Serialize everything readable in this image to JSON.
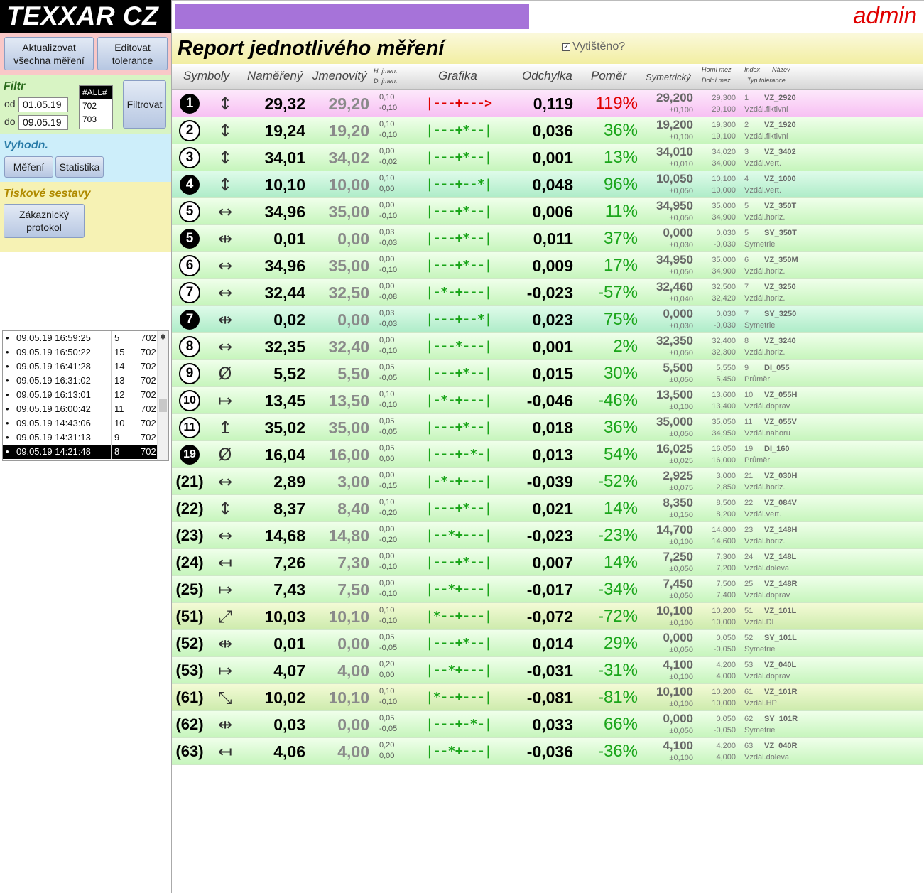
{
  "app": {
    "logo": "TEXXAR CZ",
    "user": "admin"
  },
  "sidebar": {
    "buttons": {
      "update_all": "Aktualizovat všechna měření",
      "edit_tolerance": "Editovat tolerance"
    },
    "filter": {
      "title": "Filtr",
      "from_label": "od",
      "from_value": "01.05.19",
      "to_label": "do",
      "to_value": "09.05.19",
      "list": [
        "#ALL#",
        "702",
        "703"
      ],
      "filter_button": "Filtrovat"
    },
    "eval": {
      "title": "Vyhodn.",
      "measure_button": "Měření",
      "stats_button": "Statistika"
    },
    "print": {
      "title": "Tiskové sestavy",
      "customer_protocol_button": "Zákaznický protokol"
    },
    "log": [
      {
        "bullet": "•",
        "time": "09.05.19 16:59:25",
        "count": "5",
        "code": "702"
      },
      {
        "bullet": "•",
        "time": "09.05.19 16:50:22",
        "count": "15",
        "code": "702"
      },
      {
        "bullet": "•",
        "time": "09.05.19 16:41:28",
        "count": "14",
        "code": "702"
      },
      {
        "bullet": "•",
        "time": "09.05.19 16:31:02",
        "count": "13",
        "code": "702"
      },
      {
        "bullet": "•",
        "time": "09.05.19 16:13:01",
        "count": "12",
        "code": "702"
      },
      {
        "bullet": "•",
        "time": "09.05.19 16:00:42",
        "count": "11",
        "code": "702"
      },
      {
        "bullet": "•",
        "time": "09.05.19 14:43:06",
        "count": "10",
        "code": "702"
      },
      {
        "bullet": "•",
        "time": "09.05.19 14:31:13",
        "count": "9",
        "code": "702"
      },
      {
        "bullet": "•",
        "time": "09.05.19 14:21:48",
        "count": "8",
        "code": "702"
      }
    ]
  },
  "report": {
    "title": "Report jednotlivého měření",
    "printed_label": "Vytištěno?",
    "printed_check": "✓",
    "headers": {
      "symbols": "Symboly",
      "measured": "Naměřený",
      "nominal": "Jmenovitý",
      "h_nom": "H. jmen.",
      "d_nom": "D. jmen.",
      "graph": "Grafika",
      "deviation": "Odchylka",
      "ratio": "Poměr",
      "symmetric": "Symetrický",
      "upper_limit": "Horní mez",
      "lower_limit": "Dolní mez",
      "index": "Index",
      "name": "Název",
      "tol_type": "Typ tolerance"
    },
    "rows": [
      {
        "bg": "pink",
        "badge": "1",
        "badge_style": "dark",
        "arrow": "↕",
        "measured": "29,32",
        "nominal": "29,20",
        "tol_up": "0,10",
        "tol_down": "-0,10",
        "graph": "|---+--->",
        "graph_color": "#e00000",
        "deviation": "0,119",
        "ratio": "119%",
        "ratio_color": "#e00000",
        "sym": "29,200",
        "sym_tol": "±0,100",
        "upper": "29,300",
        "lower": "29,100",
        "index": "1",
        "name": "VZ_2920",
        "type": "Vzdál.fiktivní"
      },
      {
        "bg": "green",
        "badge": "2",
        "badge_style": "light",
        "arrow": "↕",
        "measured": "19,24",
        "nominal": "19,20",
        "tol_up": "0,10",
        "tol_down": "-0,10",
        "graph": "|---+*--|",
        "graph_color": "#1aa51a",
        "deviation": "0,036",
        "ratio": "36%",
        "ratio_color": "#1aa51a",
        "sym": "19,200",
        "sym_tol": "±0,100",
        "upper": "19,300",
        "lower": "19,100",
        "index": "2",
        "name": "VZ_1920",
        "type": "Vzdál.fiktivní"
      },
      {
        "bg": "green",
        "badge": "3",
        "badge_style": "light",
        "arrow": "↕",
        "measured": "34,01",
        "nominal": "34,02",
        "tol_up": "0,00",
        "tol_down": "-0,02",
        "graph": "|---+*--|",
        "graph_color": "#1aa51a",
        "deviation": "0,001",
        "ratio": "13%",
        "ratio_color": "#1aa51a",
        "sym": "34,010",
        "sym_tol": "±0,010",
        "upper": "34,020",
        "lower": "34,000",
        "index": "3",
        "name": "VZ_3402",
        "type": "Vzdál.vert."
      },
      {
        "bg": "teal",
        "badge": "4",
        "badge_style": "dark",
        "arrow": "↕",
        "measured": "10,10",
        "nominal": "10,00",
        "tol_up": "0,10",
        "tol_down": "0,00",
        "graph": "|---+--*|",
        "graph_color": "#1aa51a",
        "deviation": "0,048",
        "ratio": "96%",
        "ratio_color": "#1aa51a",
        "sym": "10,050",
        "sym_tol": "±0,050",
        "upper": "10,100",
        "lower": "10,000",
        "index": "4",
        "name": "VZ_1000",
        "type": "Vzdál.vert."
      },
      {
        "bg": "green",
        "badge": "5",
        "badge_style": "light",
        "arrow": "↔",
        "measured": "34,96",
        "nominal": "35,00",
        "tol_up": "0,00",
        "tol_down": "-0,10",
        "graph": "|---+*--|",
        "graph_color": "#1aa51a",
        "deviation": "0,006",
        "ratio": "11%",
        "ratio_color": "#1aa51a",
        "sym": "34,950",
        "sym_tol": "±0,050",
        "upper": "35,000",
        "lower": "34,900",
        "index": "5",
        "name": "VZ_350T",
        "type": "Vzdál.horiz."
      },
      {
        "bg": "green",
        "badge": "5",
        "badge_style": "dark",
        "arrow": "⇹",
        "measured": "0,01",
        "nominal": "0,00",
        "tol_up": "0,03",
        "tol_down": "-0,03",
        "graph": "|---+*--|",
        "graph_color": "#1aa51a",
        "deviation": "0,011",
        "ratio": "37%",
        "ratio_color": "#1aa51a",
        "sym": "0,000",
        "sym_tol": "±0,030",
        "upper": "0,030",
        "lower": "-0,030",
        "index": "5",
        "name": "SY_350T",
        "type": "Symetrie"
      },
      {
        "bg": "green",
        "badge": "6",
        "badge_style": "light",
        "arrow": "↔",
        "measured": "34,96",
        "nominal": "35,00",
        "tol_up": "0,00",
        "tol_down": "-0,10",
        "graph": "|---+*--|",
        "graph_color": "#1aa51a",
        "deviation": "0,009",
        "ratio": "17%",
        "ratio_color": "#1aa51a",
        "sym": "34,950",
        "sym_tol": "±0,050",
        "upper": "35,000",
        "lower": "34,900",
        "index": "6",
        "name": "VZ_350M",
        "type": "Vzdál.horiz."
      },
      {
        "bg": "green",
        "badge": "7",
        "badge_style": "light",
        "arrow": "↔",
        "measured": "32,44",
        "nominal": "32,50",
        "tol_up": "0,00",
        "tol_down": "-0,08",
        "graph": "|-*-+---|",
        "graph_color": "#1aa51a",
        "deviation": "-0,023",
        "ratio": "-57%",
        "ratio_color": "#1aa51a",
        "sym": "32,460",
        "sym_tol": "±0,040",
        "upper": "32,500",
        "lower": "32,420",
        "index": "7",
        "name": "VZ_3250",
        "type": "Vzdál.horiz."
      },
      {
        "bg": "teal",
        "badge": "7",
        "badge_style": "dark",
        "arrow": "⇹",
        "measured": "0,02",
        "nominal": "0,00",
        "tol_up": "0,03",
        "tol_down": "-0,03",
        "graph": "|---+--*|",
        "graph_color": "#1aa51a",
        "deviation": "0,023",
        "ratio": "75%",
        "ratio_color": "#1aa51a",
        "sym": "0,000",
        "sym_tol": "±0,030",
        "upper": "0,030",
        "lower": "-0,030",
        "index": "7",
        "name": "SY_3250",
        "type": "Symetrie"
      },
      {
        "bg": "green",
        "badge": "8",
        "badge_style": "light",
        "arrow": "↔",
        "measured": "32,35",
        "nominal": "32,40",
        "tol_up": "0,00",
        "tol_down": "-0,10",
        "graph": "|---*---|",
        "graph_color": "#1aa51a",
        "deviation": "0,001",
        "ratio": "2%",
        "ratio_color": "#1aa51a",
        "sym": "32,350",
        "sym_tol": "±0,050",
        "upper": "32,400",
        "lower": "32,300",
        "index": "8",
        "name": "VZ_3240",
        "type": "Vzdál.horiz."
      },
      {
        "bg": "green",
        "badge": "9",
        "badge_style": "light",
        "arrow": "Ø",
        "measured": "5,52",
        "nominal": "5,50",
        "tol_up": "0,05",
        "tol_down": "-0,05",
        "graph": "|---+*--|",
        "graph_color": "#1aa51a",
        "deviation": "0,015",
        "ratio": "30%",
        "ratio_color": "#1aa51a",
        "sym": "5,500",
        "sym_tol": "±0,050",
        "upper": "5,550",
        "lower": "5,450",
        "index": "9",
        "name": "DI_055",
        "type": "Průměr"
      },
      {
        "bg": "green",
        "badge": "10",
        "badge_style": "light",
        "arrow": "↦",
        "measured": "13,45",
        "nominal": "13,50",
        "tol_up": "0,10",
        "tol_down": "-0,10",
        "graph": "|-*-+---|",
        "graph_color": "#1aa51a",
        "deviation": "-0,046",
        "ratio": "-46%",
        "ratio_color": "#1aa51a",
        "sym": "13,500",
        "sym_tol": "±0,100",
        "upper": "13,600",
        "lower": "13,400",
        "index": "10",
        "name": "VZ_055H",
        "type": "Vzdál.doprav"
      },
      {
        "bg": "green",
        "badge": "11",
        "badge_style": "light",
        "arrow": "↥",
        "measured": "35,02",
        "nominal": "35,00",
        "tol_up": "0,05",
        "tol_down": "-0,05",
        "graph": "|---+*--|",
        "graph_color": "#1aa51a",
        "deviation": "0,018",
        "ratio": "36%",
        "ratio_color": "#1aa51a",
        "sym": "35,000",
        "sym_tol": "±0,050",
        "upper": "35,050",
        "lower": "34,950",
        "index": "11",
        "name": "VZ_055V",
        "type": "Vzdál.nahoru"
      },
      {
        "bg": "green",
        "badge": "19",
        "badge_style": "dark",
        "arrow": "Ø",
        "measured": "16,04",
        "nominal": "16,00",
        "tol_up": "0,05",
        "tol_down": "0,00",
        "graph": "|---+-*-|",
        "graph_color": "#1aa51a",
        "deviation": "0,013",
        "ratio": "54%",
        "ratio_color": "#1aa51a",
        "sym": "16,025",
        "sym_tol": "±0,025",
        "upper": "16,050",
        "lower": "16,000",
        "index": "19",
        "name": "DI_160",
        "type": "Průměr"
      },
      {
        "bg": "green",
        "badge": "(21)",
        "badge_style": "text",
        "arrow": "↔",
        "measured": "2,89",
        "nominal": "3,00",
        "tol_up": "0,00",
        "tol_down": "-0,15",
        "graph": "|-*-+---|",
        "graph_color": "#1aa51a",
        "deviation": "-0,039",
        "ratio": "-52%",
        "ratio_color": "#1aa51a",
        "sym": "2,925",
        "sym_tol": "±0,075",
        "upper": "3,000",
        "lower": "2,850",
        "index": "21",
        "name": "VZ_030H",
        "type": "Vzdál.horiz."
      },
      {
        "bg": "green",
        "badge": "(22)",
        "badge_style": "text",
        "arrow": "↕",
        "measured": "8,37",
        "nominal": "8,40",
        "tol_up": "0,10",
        "tol_down": "-0,20",
        "graph": "|---+*--|",
        "graph_color": "#1aa51a",
        "deviation": "0,021",
        "ratio": "14%",
        "ratio_color": "#1aa51a",
        "sym": "8,350",
        "sym_tol": "±0,150",
        "upper": "8,500",
        "lower": "8,200",
        "index": "22",
        "name": "VZ_084V",
        "type": "Vzdál.vert."
      },
      {
        "bg": "green",
        "badge": "(23)",
        "badge_style": "text",
        "arrow": "↔",
        "measured": "14,68",
        "nominal": "14,80",
        "tol_up": "0,00",
        "tol_down": "-0,20",
        "graph": "|--*+---|",
        "graph_color": "#1aa51a",
        "deviation": "-0,023",
        "ratio": "-23%",
        "ratio_color": "#1aa51a",
        "sym": "14,700",
        "sym_tol": "±0,100",
        "upper": "14,800",
        "lower": "14,600",
        "index": "23",
        "name": "VZ_148H",
        "type": "Vzdál.horiz."
      },
      {
        "bg": "green",
        "badge": "(24)",
        "badge_style": "text",
        "arrow": "↤",
        "measured": "7,26",
        "nominal": "7,30",
        "tol_up": "0,00",
        "tol_down": "-0,10",
        "graph": "|---+*--|",
        "graph_color": "#1aa51a",
        "deviation": "0,007",
        "ratio": "14%",
        "ratio_color": "#1aa51a",
        "sym": "7,250",
        "sym_tol": "±0,050",
        "upper": "7,300",
        "lower": "7,200",
        "index": "24",
        "name": "VZ_148L",
        "type": "Vzdál.doleva"
      },
      {
        "bg": "green",
        "badge": "(25)",
        "badge_style": "text",
        "arrow": "↦",
        "measured": "7,43",
        "nominal": "7,50",
        "tol_up": "0,00",
        "tol_down": "-0,10",
        "graph": "|--*+---|",
        "graph_color": "#1aa51a",
        "deviation": "-0,017",
        "ratio": "-34%",
        "ratio_color": "#1aa51a",
        "sym": "7,450",
        "sym_tol": "±0,050",
        "upper": "7,500",
        "lower": "7,400",
        "index": "25",
        "name": "VZ_148R",
        "type": "Vzdál.doprav"
      },
      {
        "bg": "lime",
        "badge": "(51)",
        "badge_style": "text",
        "arrow": "⤢",
        "measured": "10,03",
        "nominal": "10,10",
        "tol_up": "0,10",
        "tol_down": "-0,10",
        "graph": "|*--+---|",
        "graph_color": "#1aa51a",
        "deviation": "-0,072",
        "ratio": "-72%",
        "ratio_color": "#1aa51a",
        "sym": "10,100",
        "sym_tol": "±0,100",
        "upper": "10,200",
        "lower": "10,000",
        "index": "51",
        "name": "VZ_101L",
        "type": "Vzdál.DL"
      },
      {
        "bg": "green",
        "badge": "(52)",
        "badge_style": "text",
        "arrow": "⇹",
        "measured": "0,01",
        "nominal": "0,00",
        "tol_up": "0,05",
        "tol_down": "-0,05",
        "graph": "|---+*--|",
        "graph_color": "#1aa51a",
        "deviation": "0,014",
        "ratio": "29%",
        "ratio_color": "#1aa51a",
        "sym": "0,000",
        "sym_tol": "±0,050",
        "upper": "0,050",
        "lower": "-0,050",
        "index": "52",
        "name": "SY_101L",
        "type": "Symetrie"
      },
      {
        "bg": "green",
        "badge": "(53)",
        "badge_style": "text",
        "arrow": "↦",
        "measured": "4,07",
        "nominal": "4,00",
        "tol_up": "0,20",
        "tol_down": "0,00",
        "graph": "|--*+---|",
        "graph_color": "#1aa51a",
        "deviation": "-0,031",
        "ratio": "-31%",
        "ratio_color": "#1aa51a",
        "sym": "4,100",
        "sym_tol": "±0,100",
        "upper": "4,200",
        "lower": "4,000",
        "index": "53",
        "name": "VZ_040L",
        "type": "Vzdál.doprav"
      },
      {
        "bg": "lime",
        "badge": "(61)",
        "badge_style": "text",
        "arrow": "⤡",
        "measured": "10,02",
        "nominal": "10,10",
        "tol_up": "0,10",
        "tol_down": "-0,10",
        "graph": "|*--+---|",
        "graph_color": "#1aa51a",
        "deviation": "-0,081",
        "ratio": "-81%",
        "ratio_color": "#1aa51a",
        "sym": "10,100",
        "sym_tol": "±0,100",
        "upper": "10,200",
        "lower": "10,000",
        "index": "61",
        "name": "VZ_101R",
        "type": "Vzdál.HP"
      },
      {
        "bg": "green",
        "badge": "(62)",
        "badge_style": "text",
        "arrow": "⇹",
        "measured": "0,03",
        "nominal": "0,00",
        "tol_up": "0,05",
        "tol_down": "-0,05",
        "graph": "|---+-*-|",
        "graph_color": "#1aa51a",
        "deviation": "0,033",
        "ratio": "66%",
        "ratio_color": "#1aa51a",
        "sym": "0,000",
        "sym_tol": "±0,050",
        "upper": "0,050",
        "lower": "-0,050",
        "index": "62",
        "name": "SY_101R",
        "type": "Symetrie"
      },
      {
        "bg": "green",
        "badge": "(63)",
        "badge_style": "text",
        "arrow": "↤",
        "measured": "4,06",
        "nominal": "4,00",
        "tol_up": "0,20",
        "tol_down": "0,00",
        "graph": "|--*+---|",
        "graph_color": "#1aa51a",
        "deviation": "-0,036",
        "ratio": "-36%",
        "ratio_color": "#1aa51a",
        "sym": "4,100",
        "sym_tol": "±0,100",
        "upper": "4,200",
        "lower": "4,000",
        "index": "63",
        "name": "VZ_040R",
        "type": "Vzdál.doleva"
      }
    ]
  }
}
